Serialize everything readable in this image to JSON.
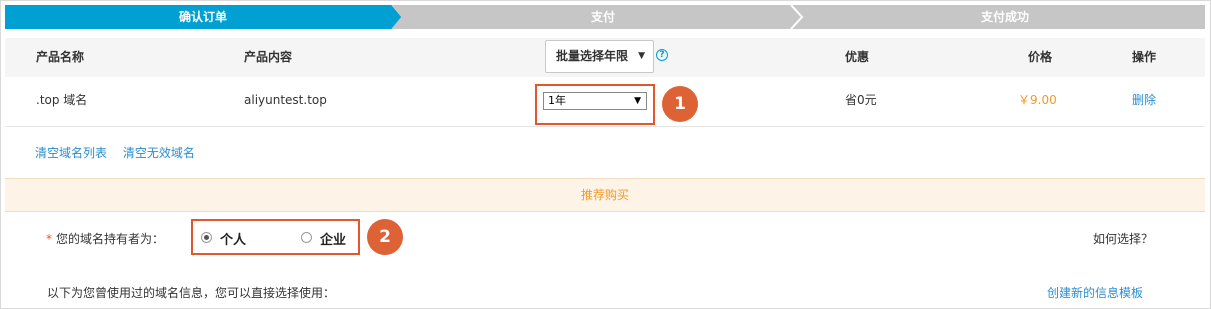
{
  "steps": [
    "确认订单",
    "支付",
    "支付成功"
  ],
  "table": {
    "headers": {
      "product_name": "产品名称",
      "product_content": "产品内容",
      "discount": "优惠",
      "price": "价格",
      "action": "操作"
    },
    "batch_select": {
      "label": "批量选择年限",
      "caret": "▼"
    },
    "help_icon": "?",
    "rows": [
      {
        "product_name": ".top 域名",
        "product_content": "aliyuntest.top",
        "years": "1年",
        "discount": "省0元",
        "price": "￥9.00",
        "action": "删除"
      }
    ]
  },
  "links": {
    "clear_list": "清空域名列表",
    "clear_invalid": "清空无效域名"
  },
  "recommend": "推荐购买",
  "owner": {
    "required_mark": "*",
    "label": "您的域名持有者为：",
    "options": [
      {
        "label": "个人",
        "checked": true
      },
      {
        "label": "企业",
        "checked": false
      }
    ],
    "how_to_choose": "如何选择？"
  },
  "info_text": "以下为您曾使用过的域名信息，您可以直接选择使用：",
  "create_template": "创建新的信息模板",
  "badges": [
    "1",
    "2"
  ],
  "colors": {
    "accent": "#00a0d2",
    "inactive_step": "#c6c6c6",
    "highlight": "#e2582c",
    "price": "#f29a29",
    "link": "#2b8ecf"
  }
}
